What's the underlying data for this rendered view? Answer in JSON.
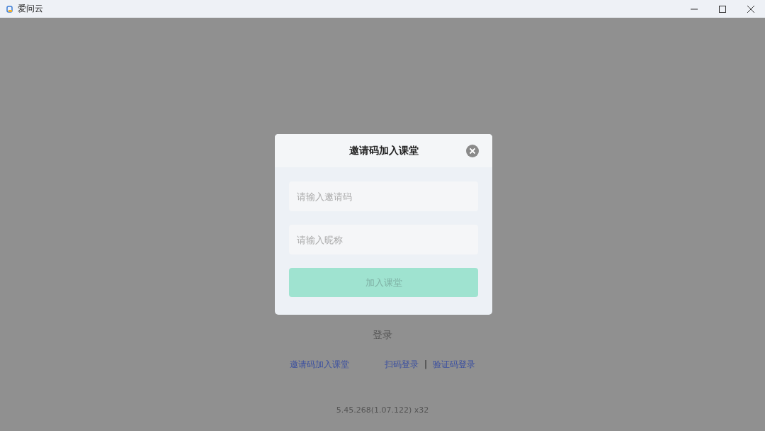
{
  "window": {
    "title": "爱问云"
  },
  "background": {
    "login_button": "登录",
    "invite_link": "邀请码加入课堂",
    "qr_login_link": "扫码登录",
    "separator": "|",
    "code_login_link": "验证码登录",
    "version": "5.45.268(1.07.122) x32"
  },
  "dialog": {
    "title": "邀请码加入课堂",
    "fields": [
      {
        "placeholder": "请输入邀请码"
      },
      {
        "placeholder": "请输入昵称"
      }
    ],
    "submit": {
      "label": "加入课堂",
      "disabled": true
    }
  }
}
